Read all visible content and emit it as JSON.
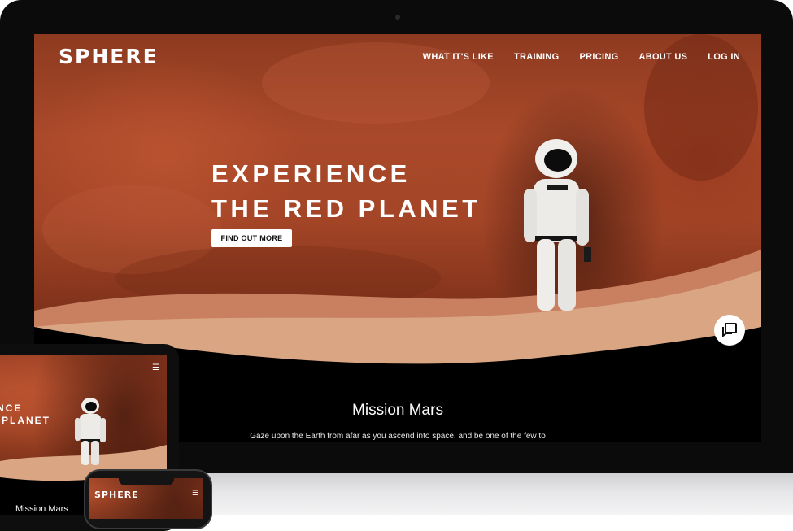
{
  "brand": {
    "logo": "SPHERE"
  },
  "nav": {
    "items": [
      "WHAT IT'S LIKE",
      "TRAINING",
      "PRICING",
      "ABOUT US",
      "LOG IN"
    ]
  },
  "hero": {
    "title_line1": "EXPERIENCE",
    "title_line2": "THE RED PLANET",
    "cta_label": "FIND OUT MORE"
  },
  "mission": {
    "title": "Mission Mars",
    "description": "Gaze upon the Earth from afar as you ascend into space, and be one of the few to"
  },
  "tablet": {
    "title_line1": "ENCE",
    "title_line2": "D PLANET",
    "mission_title": "Mission Mars",
    "menu_icon": "☰"
  },
  "phone": {
    "logo": "SPHERE",
    "menu_icon": "☰"
  },
  "icons": {
    "chat": "chat-bubble-icon",
    "menu": "hamburger-menu-icon"
  },
  "colors": {
    "mars_red": "#a44527",
    "dust": "#d8a783",
    "device_frame": "#0b0b0b",
    "text_light": "#ffffff"
  }
}
